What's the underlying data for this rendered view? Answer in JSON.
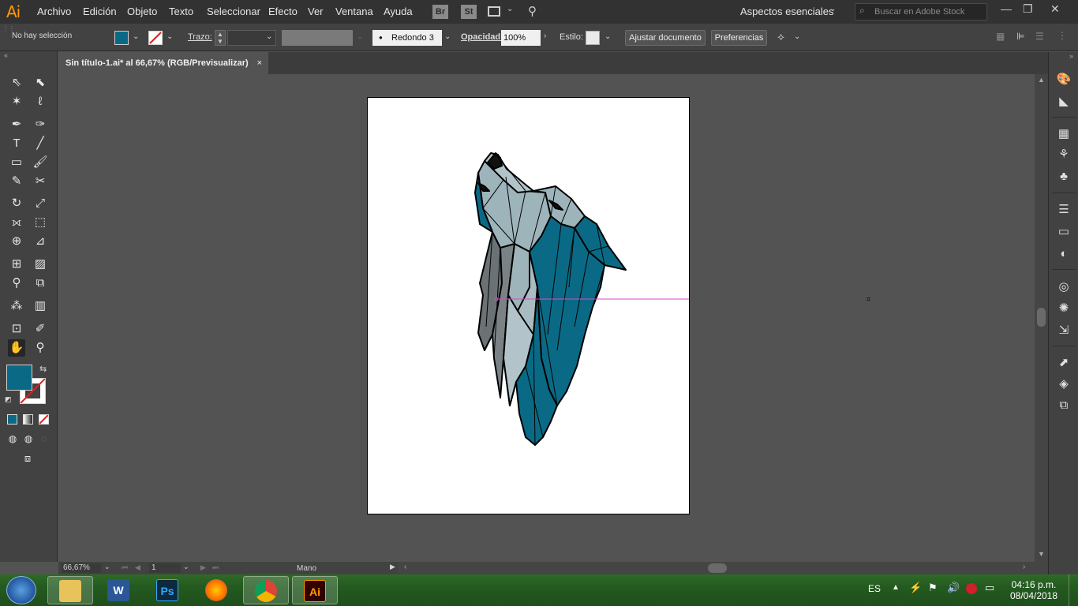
{
  "app": {
    "logo": "Ai",
    "menus": [
      "Archivo",
      "Edición",
      "Objeto",
      "Texto",
      "Seleccionar",
      "Efecto",
      "Ver",
      "Ventana",
      "Ayuda"
    ],
    "bridge_label": "Br",
    "stock_label": "St",
    "workspace": "Aspectos esenciales",
    "search_placeholder": "Buscar en Adobe Stock"
  },
  "controlbar": {
    "selection": "No hay selección",
    "stroke_label": "Trazo:",
    "brush": "Redondo 3 ...",
    "opacity_label": "Opacidad:",
    "opacity_value": "100%",
    "style_label": "Estilo:",
    "adjust_doc_button": "Ajustar documento",
    "preferences_button": "Preferencias",
    "fill_color": "#0a6a86"
  },
  "document": {
    "tab_title": "Sin título-1.ai* al 66,67% (RGB/Previsualizar)",
    "close": "×"
  },
  "statusbar": {
    "zoom": "66,67%",
    "artboard": "1",
    "tool": "Mano"
  },
  "taskbar": {
    "language": "ES",
    "time": "04:16 p.m.",
    "date": "08/04/2018",
    "apps": [
      "Explorador",
      "Word",
      "Photoshop",
      "Firefox",
      "Chrome",
      "Illustrator"
    ]
  },
  "colors": {
    "teal": "#0a6a86",
    "light_gray_blue": "#9eb4bb",
    "gray": "#6a7275",
    "guide": "#d24bd2"
  }
}
